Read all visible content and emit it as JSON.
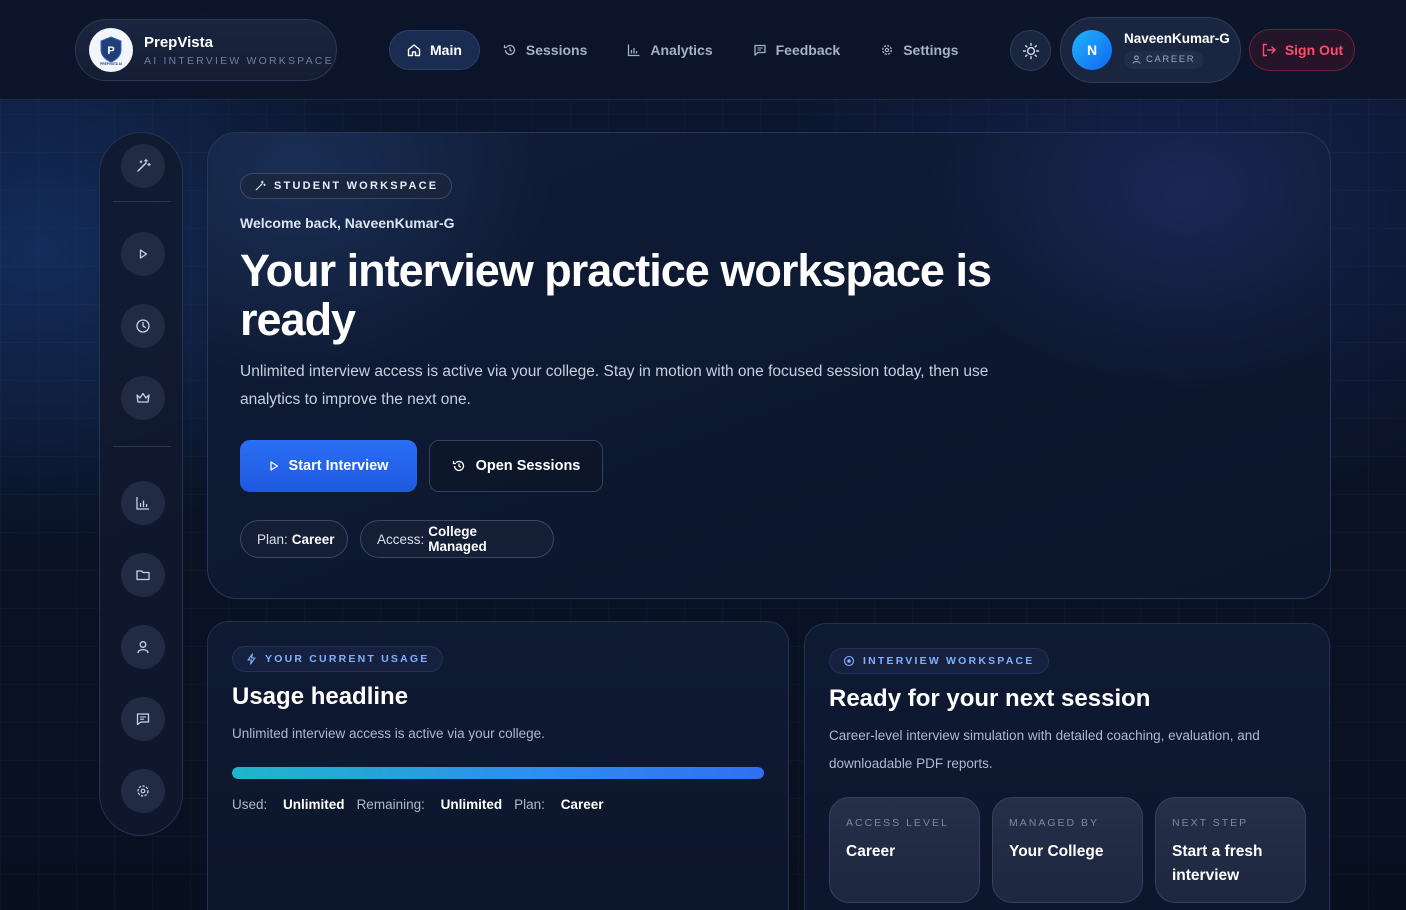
{
  "brand": {
    "name": "PrepVista",
    "subtitle": "AI INTERVIEW WORKSPACE",
    "logo_text": "PREPVISTA AI"
  },
  "nav": {
    "items": [
      {
        "label": "Main",
        "icon": "home-icon",
        "active": true
      },
      {
        "label": "Sessions",
        "icon": "history-icon"
      },
      {
        "label": "Analytics",
        "icon": "bar-chart-icon"
      },
      {
        "label": "Feedback",
        "icon": "message-icon"
      },
      {
        "label": "Settings",
        "icon": "gear-icon"
      }
    ]
  },
  "user": {
    "initial": "N",
    "name": "NaveenKumar-G",
    "role": "CAREER"
  },
  "signout_label": "Sign Out",
  "hero": {
    "tag": "STUDENT WORKSPACE",
    "welcome": "Welcome back, NaveenKumar-G",
    "title": "Your interview practice workspace is ready",
    "description": "Unlimited interview access is active via your college. Stay in motion with one focused session today, then use analytics to improve the next one.",
    "primary_button": "Start Interview",
    "secondary_button": "Open Sessions",
    "chips": [
      {
        "label": "Plan:",
        "value": "Career"
      },
      {
        "label": "Access:",
        "value": "College Managed"
      }
    ]
  },
  "usage": {
    "tag": "YOUR CURRENT USAGE",
    "title": "Usage headline",
    "text": "Unlimited interview access is active via your college.",
    "progress": 1.0,
    "stats": [
      {
        "label": "Used:",
        "value": "Unlimited"
      },
      {
        "label": "Remaining:",
        "value": "Unlimited"
      },
      {
        "label": "Plan:",
        "value": "Career"
      }
    ]
  },
  "workspace": {
    "tag": "INTERVIEW WORKSPACE",
    "title": "Ready for your next session",
    "text": "Career-level interview simulation with detailed coaching, evaluation, and downloadable PDF reports.",
    "boxes": [
      {
        "label": "ACCESS LEVEL",
        "value": "Career"
      },
      {
        "label": "MANAGED BY",
        "value": "Your College"
      },
      {
        "label": "NEXT STEP",
        "value": "Start a fresh interview"
      }
    ]
  },
  "colors": {
    "accent": "#2a6ff5",
    "signout": "#ff4d6d",
    "tag_text": "#7fb1ff"
  }
}
